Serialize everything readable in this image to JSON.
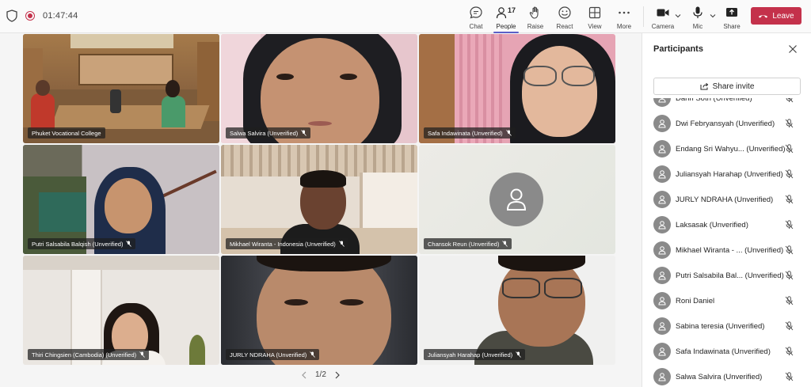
{
  "top_bar": {
    "timer": "01:47:44",
    "buttons": {
      "chat": "Chat",
      "people": "People",
      "people_count": "17",
      "raise": "Raise",
      "react": "React",
      "view": "View",
      "more": "More",
      "camera": "Camera",
      "mic": "Mic",
      "share": "Share",
      "leave": "Leave"
    }
  },
  "video_tiles": [
    {
      "name": "Phuket Vocational College",
      "muted": false
    },
    {
      "name": "Salwa Salvira (Unverified)",
      "muted": true
    },
    {
      "name": "Safa Indawinata (Unverified)",
      "muted": true
    },
    {
      "name": "Putri Salsabila Balqish (Unverified)",
      "muted": true
    },
    {
      "name": "Mikhael Wiranta - Indonesia (Unverified)",
      "muted": true
    },
    {
      "name": "Chansok Reun (Unverified)",
      "muted": true
    },
    {
      "name": "Thiri Chingsien (Cambodia) (Unverified)",
      "muted": true
    },
    {
      "name": "JURLY NDRAHA (Unverified)",
      "muted": true
    },
    {
      "name": "Juliansyah Harahap (Unverified)",
      "muted": true
    }
  ],
  "pager": {
    "label": "1/2"
  },
  "participants_panel": {
    "title": "Participants",
    "share_invite": "Share invite",
    "participants": [
      {
        "name": "Dahn Soth (Unverified)"
      },
      {
        "name": "Dwi Febryansyah (Unverified)"
      },
      {
        "name": "Endang Sri Wahyu... (Unverified)"
      },
      {
        "name": "Juliansyah Harahap (Unverified)"
      },
      {
        "name": "JURLY NDRAHA (Unverified)"
      },
      {
        "name": "Laksasak (Unverified)"
      },
      {
        "name": "Mikhael Wiranta - ... (Unverified)"
      },
      {
        "name": "Putri Salsabila Bal... (Unverified)"
      },
      {
        "name": "Roni Daniel"
      },
      {
        "name": "Sabina teresia (Unverified)"
      },
      {
        "name": "Safa Indawinata (Unverified)"
      },
      {
        "name": "Salwa Salvira (Unverified)"
      }
    ]
  },
  "colors": {
    "accent": "#5b5fc7",
    "leave": "#c4314b",
    "avatar": "#8a8a8a"
  }
}
